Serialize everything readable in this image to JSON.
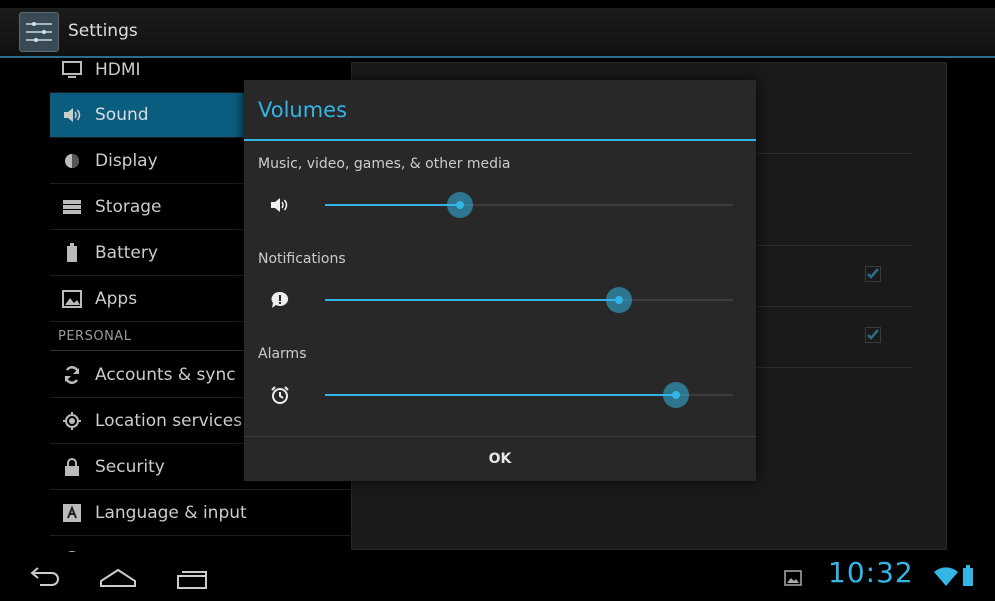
{
  "action_bar": {
    "title": "Settings",
    "icon": "settings-icon"
  },
  "settings_list": {
    "items": [
      {
        "label": "HDMI",
        "icon": "monitor-icon"
      },
      {
        "label": "Sound",
        "icon": "speaker-icon",
        "selected": true
      },
      {
        "label": "Display",
        "icon": "brightness-icon"
      },
      {
        "label": "Storage",
        "icon": "storage-icon"
      },
      {
        "label": "Battery",
        "icon": "battery-icon"
      },
      {
        "label": "Apps",
        "icon": "apps-icon"
      }
    ],
    "section_header": "PERSONAL",
    "personal_items": [
      {
        "label": "Accounts & sync",
        "icon": "sync-icon"
      },
      {
        "label": "Location services",
        "icon": "location-icon"
      },
      {
        "label": "Security",
        "icon": "lock-icon"
      },
      {
        "label": "Language & input",
        "icon": "keyboard-icon"
      }
    ]
  },
  "dialog": {
    "title": "Volumes",
    "sliders": [
      {
        "label": "Music, video, games, & other media",
        "icon": "speaker-icon",
        "level": 0.33
      },
      {
        "label": "Notifications",
        "icon": "notification-icon",
        "level": 0.72
      },
      {
        "label": "Alarms",
        "icon": "alarm-icon",
        "level": 0.86
      }
    ],
    "ok_label": "OK"
  },
  "system_bar": {
    "time": "10:32",
    "nav": [
      "back-icon",
      "home-icon",
      "recent-apps-icon"
    ],
    "status_icons": [
      "gallery-icon",
      "wifi-icon",
      "battery-icon"
    ]
  },
  "colors": {
    "accent": "#33b5e5",
    "selected_bg": "#0b5d80",
    "dialog_bg": "#282828"
  }
}
